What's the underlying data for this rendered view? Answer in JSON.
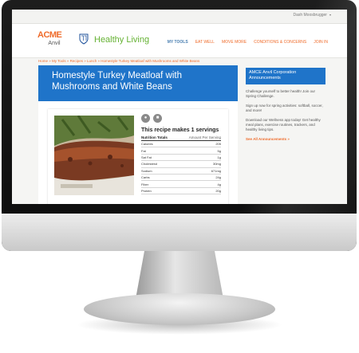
{
  "topbar": {
    "user_menu": "Dash Moosbrugger",
    "caret": "▾"
  },
  "logo": {
    "top": "ACME",
    "bottom": "Anvil",
    "mayo": "MAYO CLINIC"
  },
  "brand": {
    "name": "Healthy Living"
  },
  "nav": {
    "items": [
      {
        "label": "MY TOOLS"
      },
      {
        "label": "EAT WELL"
      },
      {
        "label": "MOVE MORE"
      },
      {
        "label": "CONDITIONS & CONCERNS"
      },
      {
        "label": "JOIN IN"
      }
    ]
  },
  "breadcrumb": "Home » My Tools » Recipes » Lunch » Homestyle Turkey Meatloaf with Mushrooms and White Beans",
  "recipe": {
    "title": "Homestyle Turkey Meatloaf with Mushrooms and White Beans",
    "servings": "This recipe makes 1 servings",
    "icons": [
      "recipe-icon",
      "print-icon"
    ],
    "nutrition_header": "Nutrition Totals",
    "amount_header": "Amount Per Serving",
    "nutrition": [
      {
        "name": "Calories",
        "value": "205"
      },
      {
        "name": "Fat",
        "value": "5g"
      },
      {
        "name": "Sat Fat",
        "value": "1g"
      },
      {
        "name": "Cholesterol",
        "value": "30mg"
      },
      {
        "name": "Sodium",
        "value": "671mg"
      },
      {
        "name": "Carbs",
        "value": "24g"
      },
      {
        "name": "Fiber",
        "value": "4g"
      },
      {
        "name": "Protein",
        "value": "20g"
      }
    ]
  },
  "sidebar": {
    "announcement_title": "AMCE Anvil Corporation Announcements",
    "p1": "Challenge yourself to better health! Join our Spring Challenge.",
    "p2": "Sign up now for spring activities: softball, soccer, and more!",
    "p3": "Download our Wellness app today! Get healthy meal plans, exercise routines, trackers, and healthy living tips.",
    "see_all": "See All Announcements »"
  },
  "colors": {
    "accent_orange": "#ef6b2a",
    "brand_green": "#65b233",
    "blue": "#1f74c9",
    "nav_active": "#4a7fb1"
  }
}
